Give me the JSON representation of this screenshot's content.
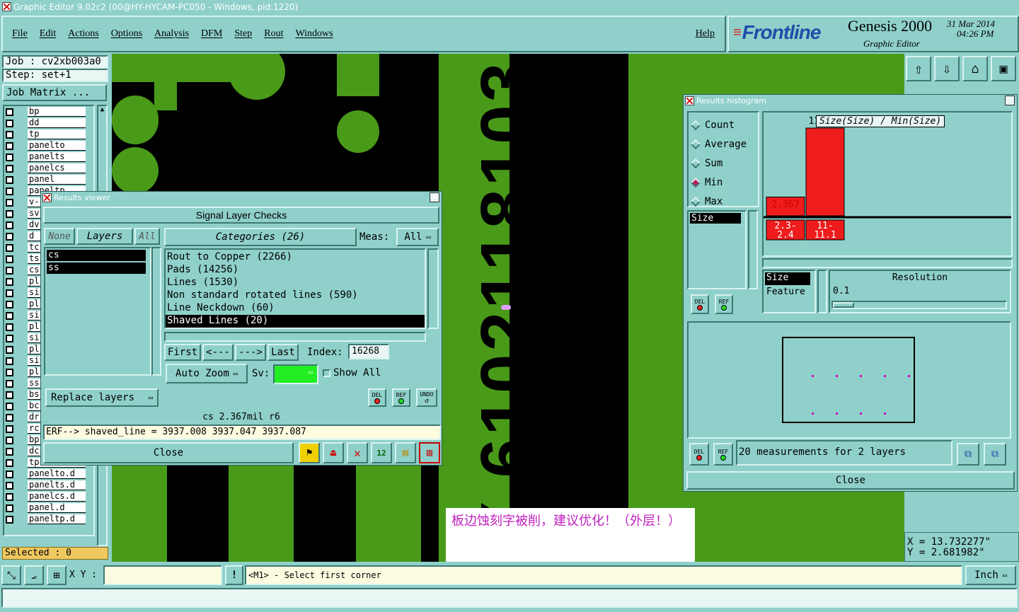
{
  "window_title": "Graphic Editor 9.02c2 (00@HY-HYCAM-PC050 - Windows, pid:1220)",
  "menu": [
    "File",
    "Edit",
    "Actions",
    "Options",
    "Analysis",
    "DFM",
    "Step",
    "Rout",
    "Windows"
  ],
  "help": "Help",
  "brand": {
    "logo": "Frontline",
    "product": "Genesis 2000",
    "sub": "Graphic Editor",
    "date": "31 Mar 2014",
    "time": "04:26 PM"
  },
  "job": {
    "job": "Job : cv2xb003a0",
    "step": "Step: set+1",
    "matrix_btn": "Job Matrix ..."
  },
  "layers": [
    {
      "name": "bp",
      "checked": false
    },
    {
      "name": "dd",
      "checked": false
    },
    {
      "name": "tp",
      "checked": false
    },
    {
      "name": "panelto",
      "checked": false
    },
    {
      "name": "panelts",
      "checked": false
    },
    {
      "name": "panelcs",
      "checked": false
    },
    {
      "name": "panel",
      "checked": false
    },
    {
      "name": "paneltp",
      "checked": false
    },
    {
      "name": "v-",
      "checked": false
    },
    {
      "name": "sv",
      "checked": false
    },
    {
      "name": "dv",
      "checked": false
    },
    {
      "name": "d",
      "checked": false
    },
    {
      "name": "tc",
      "checked": false
    },
    {
      "name": "ts",
      "checked": false
    },
    {
      "name": "cs",
      "checked": false
    },
    {
      "name": "pl",
      "checked": false
    },
    {
      "name": "si",
      "checked": false
    },
    {
      "name": "pl",
      "checked": false
    },
    {
      "name": "si",
      "checked": false
    },
    {
      "name": "pl",
      "checked": false
    },
    {
      "name": "si",
      "checked": false
    },
    {
      "name": "pl",
      "checked": false
    },
    {
      "name": "si",
      "checked": false
    },
    {
      "name": "pl",
      "checked": false
    },
    {
      "name": "ss",
      "checked": false
    },
    {
      "name": "bs",
      "checked": false
    },
    {
      "name": "bc",
      "checked": false
    },
    {
      "name": "dr",
      "checked": false
    },
    {
      "name": "rc",
      "checked": false
    },
    {
      "name": "bp",
      "checked": false
    },
    {
      "name": "dc",
      "checked": false
    },
    {
      "name": "tp.d",
      "checked": false
    },
    {
      "name": "panelto.d",
      "checked": false
    },
    {
      "name": "panelts.d",
      "checked": false
    },
    {
      "name": "panelcs.d",
      "checked": false
    },
    {
      "name": "panel.d",
      "checked": false
    },
    {
      "name": "paneltp.d",
      "checked": false
    }
  ],
  "selected": "Selected : 0",
  "canvas_text": "Y 6102118103",
  "annotation": "板边蚀刻字被削，建议优化！（外层！）",
  "coords": {
    "x": "X = 13.732277\"",
    "y": "Y = 2.681982\""
  },
  "bottom": {
    "xy_label": "X Y :",
    "xy_value": "",
    "prompt": "<M1> - Select first corner",
    "unit": "Inch"
  },
  "results_viewer": {
    "title": "Results viewer",
    "heading": "Signal Layer Checks",
    "none": "None",
    "layers": "Layers",
    "all": "All",
    "layer_list": [
      "cs",
      "ss"
    ],
    "categories_label": "Categories (26)",
    "meas_label": "Meas:",
    "meas_value": "All",
    "categories": [
      "Rout to Copper (2266)",
      "Pads (14256)",
      "Lines (1530)",
      "Non standard rotated lines (590)",
      "Line Neckdown (60)",
      "Shaved Lines (20)"
    ],
    "nav": [
      "First",
      "<---",
      "--->",
      "Last"
    ],
    "index_label": "Index:",
    "index_value": "16268",
    "auto_zoom": "Auto Zoom",
    "sv_label": "Sv:",
    "show_all": "Show All",
    "replace": "Replace layers",
    "status": "cs 2.367mil  r6",
    "erf": "ERF--> shaved_line = 3937.008 3937.047 3937.087",
    "close": "Close",
    "del": "DEL",
    "ref": "REF",
    "undo": "UNDO"
  },
  "histogram": {
    "title": "Results histogram",
    "modes": [
      {
        "label": "Count",
        "on": false
      },
      {
        "label": "Average",
        "on": false
      },
      {
        "label": "Sum",
        "on": false
      },
      {
        "label": "Min",
        "on": true
      },
      {
        "label": "Max",
        "on": false
      }
    ],
    "field_sel": "Size",
    "chart_title": "Size(Size) / Min(Size)",
    "bars": [
      {
        "label": "2.3-\n2.4",
        "value": 2.367,
        "disp": "2.367"
      },
      {
        "label": "11-\n11.1",
        "value": 11.063,
        "disp": "11.063"
      }
    ],
    "attr_list": [
      "Size",
      "Feature"
    ],
    "resolution_label": "Resolution",
    "resolution_value": "0.1",
    "measurements": "20 measurements for 2 layers",
    "close": "Close",
    "del": "DEL",
    "ref": "REF"
  },
  "chart_data": {
    "type": "bar",
    "title": "Size(Size) / Min(Size)",
    "categories": [
      "2.3-2.4",
      "11-11.1"
    ],
    "values": [
      2.367,
      11.063
    ],
    "colors": [
      "#ee1c1c"
    ]
  }
}
